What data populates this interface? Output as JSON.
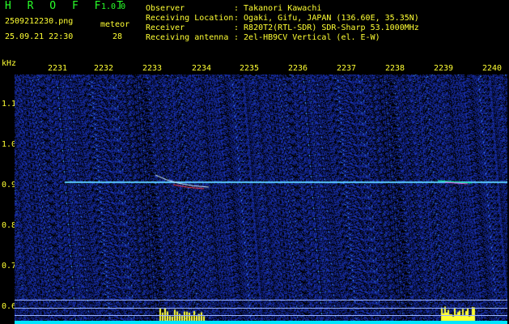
{
  "header": {
    "app_title": "H R O F F T",
    "version": "1.0.0",
    "file_name": "2509212230.png",
    "meteor_label": "meteor",
    "datetime": "25.09.21 22:30",
    "meteor_count": "28"
  },
  "info": {
    "labels": [
      "Observer",
      "Receiving Location",
      "Receiver",
      "Receiving antenna"
    ],
    "values": [
      ": Takanori Kawachi",
      ": Ogaki, Gifu, JAPAN (136.60E, 35.35N)",
      ": R820T2(RTL-SDR) SDR-Sharp 53.1000MHz",
      ": 2el-HB9CV Vertical (el. E-W)"
    ]
  },
  "axis": {
    "unit": "kHz",
    "x_ticks": [
      "2231",
      "2232",
      "2233",
      "2234",
      "2235",
      "2236",
      "2237",
      "2238",
      "2239",
      "2240"
    ],
    "y_ticks": [
      "1.1",
      "1.0",
      "0.9",
      "0.8",
      "0.7",
      "0.6"
    ]
  },
  "colors": {
    "title": "#29ff29",
    "text": "#ffff33",
    "background": "#000000",
    "noise": "#1f2f96",
    "carrier": "#59c9ff",
    "signal": "#00e5ff"
  }
}
